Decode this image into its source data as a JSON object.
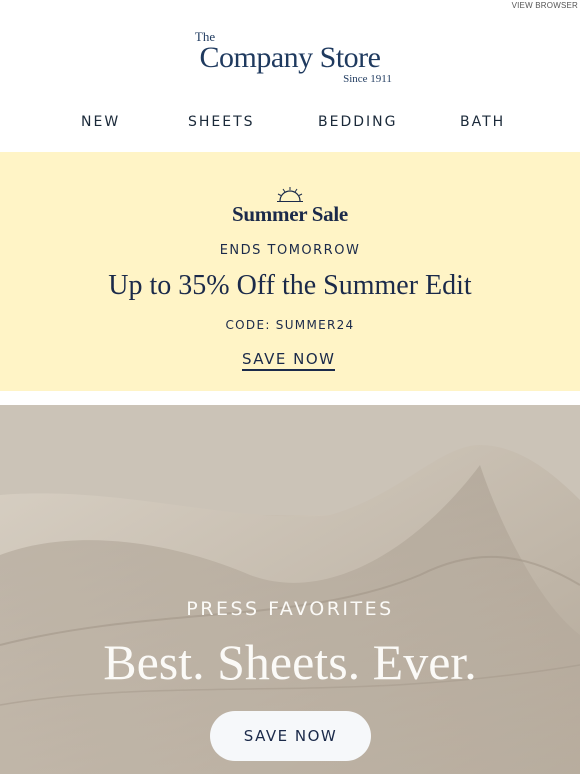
{
  "topbar": {
    "view_browser": "VIEW BROWSER"
  },
  "logo": {
    "the": "The",
    "name": "Company Store",
    "since": "Since 1911"
  },
  "nav": {
    "items": [
      "NEW",
      "SHEETS",
      "BEDDING",
      "BATH"
    ]
  },
  "promo": {
    "title": "Summer Sale",
    "ends": "ENDS TOMORROW",
    "headline": "Up to 35% Off the Summer Edit",
    "code": "CODE: SUMMER24",
    "cta": "SAVE NOW",
    "bg_color": "#fff4c6"
  },
  "hero": {
    "kicker": "PRESS FAVORITES",
    "headline": "Best. Sheets. Ever.",
    "cta": "SAVE NOW"
  }
}
